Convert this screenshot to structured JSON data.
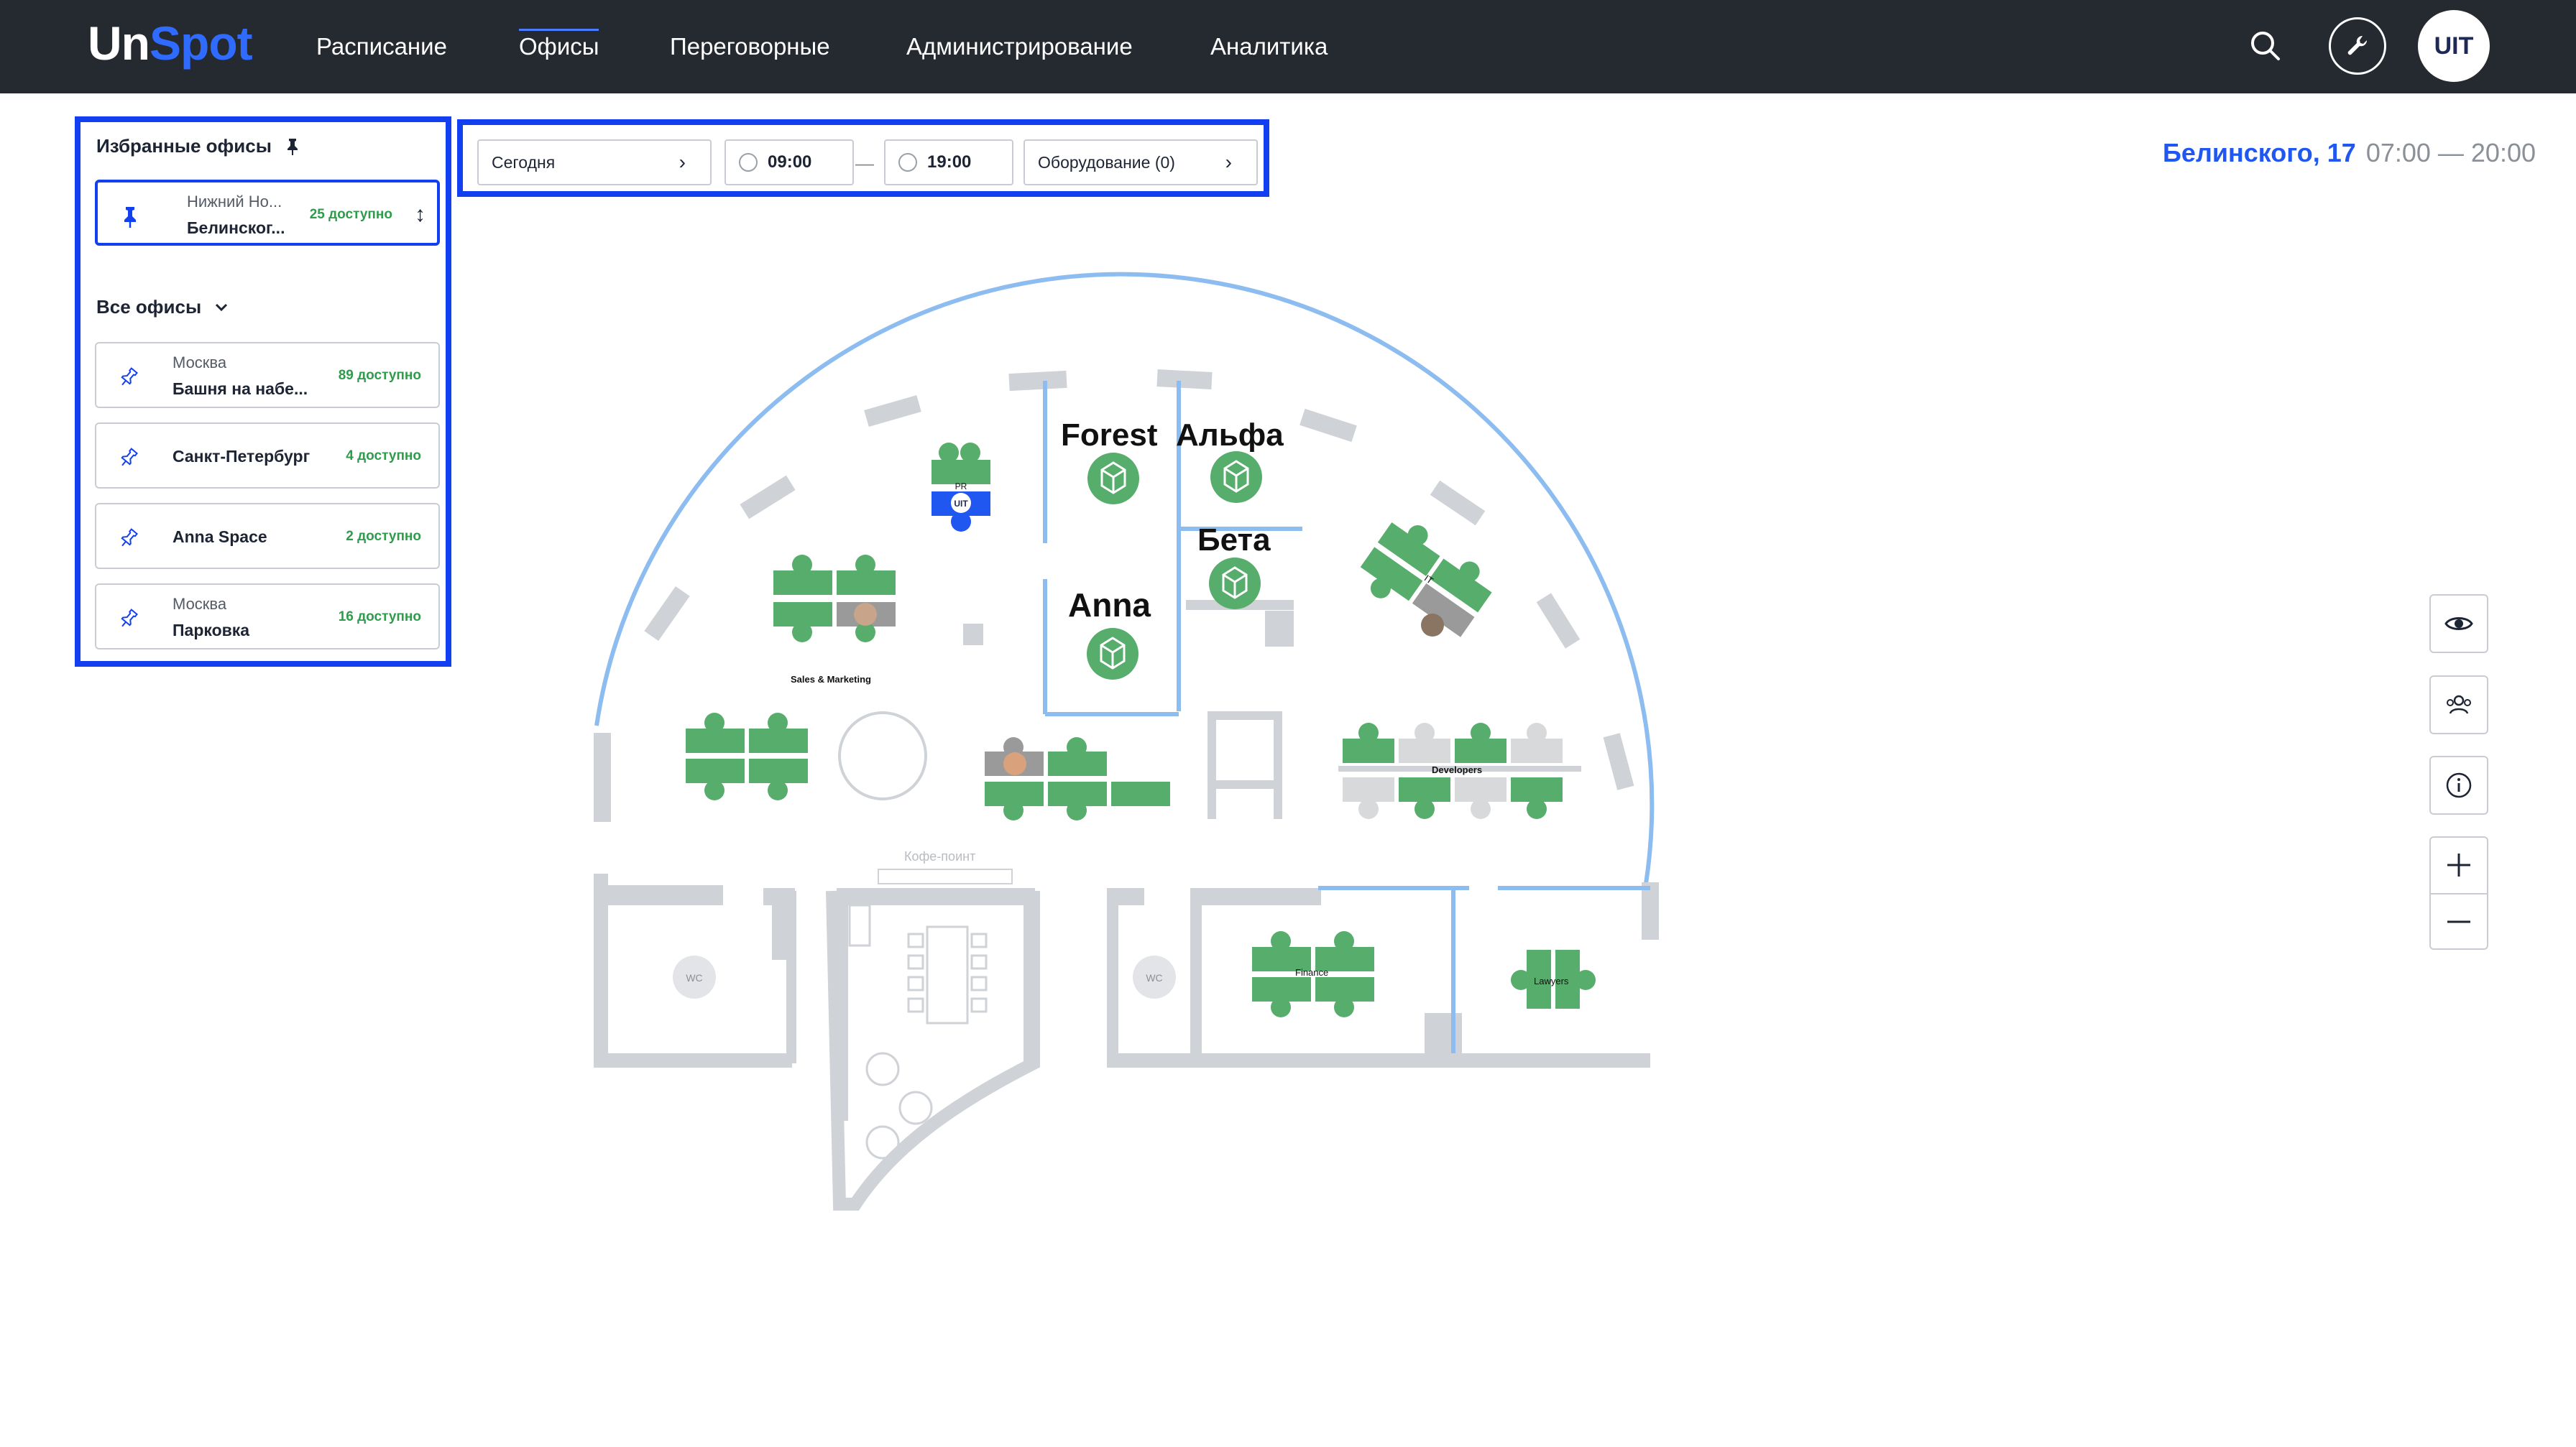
{
  "header": {
    "logo_part1": "Un",
    "logo_part2": "Spot",
    "nav": [
      {
        "label": "Расписание",
        "active": false
      },
      {
        "label": "Офисы",
        "active": true
      },
      {
        "label": "Переговорные",
        "active": false
      },
      {
        "label": "Администрирование",
        "active": false
      },
      {
        "label": "Аналитика",
        "active": false
      }
    ],
    "avatar_text": "UIT",
    "icons": [
      "search-icon",
      "wrench-icon"
    ]
  },
  "sidebar": {
    "favorites_title": "Избранные офисы",
    "favorites": [
      {
        "city": "Нижний Но...",
        "name": "Белинског...",
        "available": "25 доступно"
      }
    ],
    "all_title": "Все офисы",
    "offices": [
      {
        "city": "Москва",
        "name": "Башня на набе...",
        "available": "89 доступно"
      },
      {
        "city": "",
        "name": "Санкт-Петербург",
        "available": "4 доступно"
      },
      {
        "city": "",
        "name": "Anna Space",
        "available": "2 доступно"
      },
      {
        "city": "Москва",
        "name": "Парковка",
        "available": "16 доступно"
      }
    ]
  },
  "filters": {
    "date": "Сегодня",
    "time_from": "09:00",
    "time_to": "19:00",
    "separator": "—",
    "equipment": "Оборудование (0)"
  },
  "office_info": {
    "address": "Белинского, 17",
    "hours": "07:00 — 20:00"
  },
  "map": {
    "rooms": [
      "Forest",
      "Альфа",
      "Бета",
      "Anna"
    ],
    "zones": [
      "Sales & Marketing",
      "Developers",
      "Finance",
      "Lawyers",
      "PR",
      "IT"
    ],
    "facilities": [
      "Кофе-поинт",
      "WC",
      "WC"
    ],
    "seat_avatar": "UIT"
  },
  "controls": [
    "eye-icon",
    "people-icon",
    "info-icon",
    "zoom-in-icon",
    "zoom-out-icon"
  ],
  "colors": {
    "accent": "#1f57f0",
    "desk_free": "#57ad6b",
    "desk_busy": "#d8d9db",
    "wall": "#cfd2d6",
    "glass": "#8cbcf0",
    "header_bg": "#252a31"
  }
}
